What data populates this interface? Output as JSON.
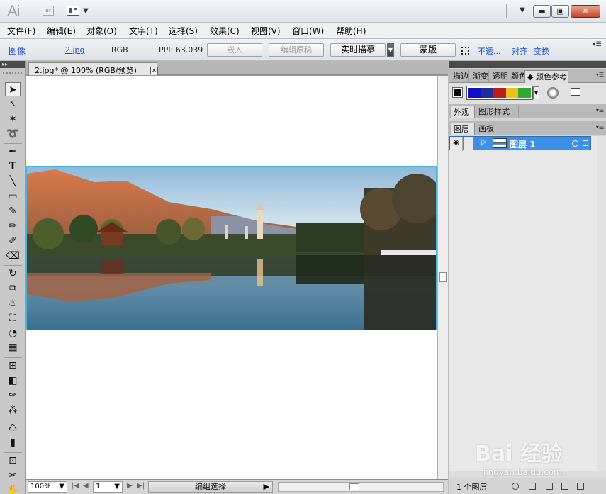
{
  "app": {
    "logo": "Ai",
    "bridge_label": "Br"
  },
  "menu": [
    "文件(F)",
    "编辑(E)",
    "对象(O)",
    "文字(T)",
    "选择(S)",
    "效果(C)",
    "视图(V)",
    "窗口(W)",
    "帮助(H)"
  ],
  "control": {
    "object_type": "图像",
    "file_link": "2.jpg",
    "color_mode": "RGB",
    "ppi": "PPI: 63.039",
    "embed": "嵌入",
    "edit_original": "编辑原稿",
    "live_trace": "实时描摹",
    "mask": "蒙版",
    "opacity": "不透...",
    "align": "对齐",
    "transform": "变换"
  },
  "document": {
    "tab_title": "2.jpg* @ 100% (RGB/预览)",
    "zoom": "100%",
    "page": "1",
    "status": "编组选择"
  },
  "panels": {
    "tabs_top": [
      "描边",
      "渐变",
      "透明",
      "颜色",
      "颜色参考"
    ],
    "tabs_mid": [
      "外观",
      "图形样式"
    ],
    "tabs_layers": [
      "图层",
      "画板"
    ],
    "harmony_colors": [
      "#1010c8",
      "#1a2fa0",
      "#c21a1a",
      "#e8c21a",
      "#2eaa2e"
    ],
    "layer": {
      "name": "图层 1"
    },
    "layer_count": "1 个图层"
  },
  "watermark": {
    "main": "Bai 经验",
    "sub": "jingyan.baidu.com"
  },
  "colors": {
    "accent": "#3e8fe6",
    "link": "#1a4cc4",
    "chrome": "#d4d4d4"
  }
}
